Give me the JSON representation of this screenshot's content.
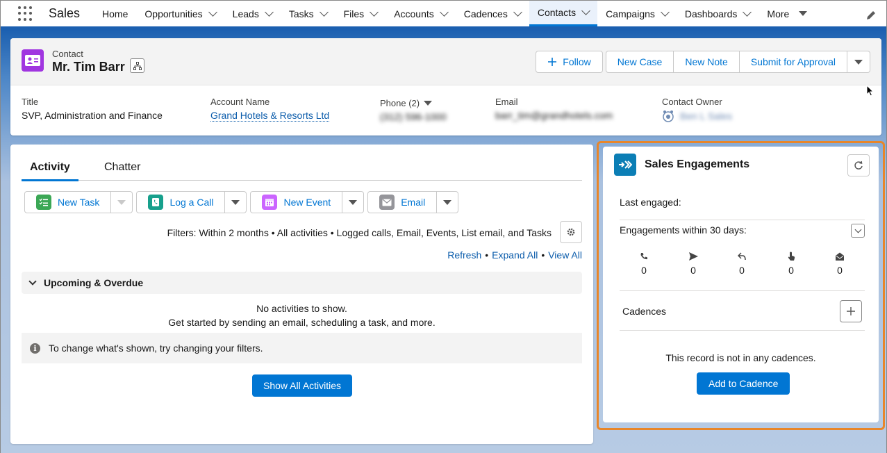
{
  "app": {
    "name": "Sales"
  },
  "nav": {
    "items": [
      {
        "label": "Home",
        "chevron": false
      },
      {
        "label": "Opportunities",
        "chevron": true
      },
      {
        "label": "Leads",
        "chevron": true
      },
      {
        "label": "Tasks",
        "chevron": true
      },
      {
        "label": "Files",
        "chevron": true
      },
      {
        "label": "Accounts",
        "chevron": true
      },
      {
        "label": "Cadences",
        "chevron": true
      },
      {
        "label": "Contacts",
        "chevron": true,
        "active": true
      },
      {
        "label": "Campaigns",
        "chevron": true
      },
      {
        "label": "Dashboards",
        "chevron": true
      }
    ],
    "more_label": "More"
  },
  "record": {
    "object_label": "Contact",
    "name": "Mr. Tim Barr",
    "buttons": {
      "follow": "Follow",
      "new_case": "New Case",
      "new_note": "New Note",
      "submit": "Submit for Approval"
    },
    "fields": {
      "title_label": "Title",
      "title_value": "SVP, Administration and Finance",
      "account_label": "Account Name",
      "account_value": "Grand Hotels & Resorts Ltd",
      "phone_label": "Phone (2)",
      "phone_value": "(312) 596-1000",
      "email_label": "Email",
      "email_value": "barr_tim@grandhotels.com",
      "owner_label": "Contact Owner",
      "owner_value": "Ben L Sales"
    }
  },
  "activity": {
    "tabs": [
      "Activity",
      "Chatter"
    ],
    "actions": {
      "new_task": "New Task",
      "log_call": "Log a Call",
      "new_event": "New Event",
      "email": "Email"
    },
    "filters_text": "Filters: Within 2 months • All activities • Logged calls, Email, Events, List email, and Tasks",
    "links": {
      "refresh": "Refresh",
      "expand_all": "Expand All",
      "view_all": "View All",
      "sep": "•"
    },
    "upcoming_label": "Upcoming & Overdue",
    "no_activities": "No activities to show.",
    "get_started": "Get started by sending an email, scheduling a task, and more.",
    "info_icon": "i",
    "info_text": "To change what's shown, try changing your filters.",
    "show_all": "Show All Activities"
  },
  "engagement": {
    "title": "Sales Engagements",
    "last_engaged_label": "Last engaged:",
    "within_label": "Engagements within 30 days:",
    "stats": [
      {
        "icon": "phone-icon",
        "value": "0"
      },
      {
        "icon": "send-icon",
        "value": "0"
      },
      {
        "icon": "reply-icon",
        "value": "0"
      },
      {
        "icon": "click-icon",
        "value": "0"
      },
      {
        "icon": "email-open-icon",
        "value": "0"
      }
    ],
    "cadences_label": "Cadences",
    "not_in_text": "This record is not in any cadences.",
    "add_button": "Add to Cadence"
  },
  "colors": {
    "brand": "#0176d3",
    "highlight": "#e8862a",
    "contact_icon": "#a035e0",
    "engagement_icon": "#0b7eb5"
  }
}
